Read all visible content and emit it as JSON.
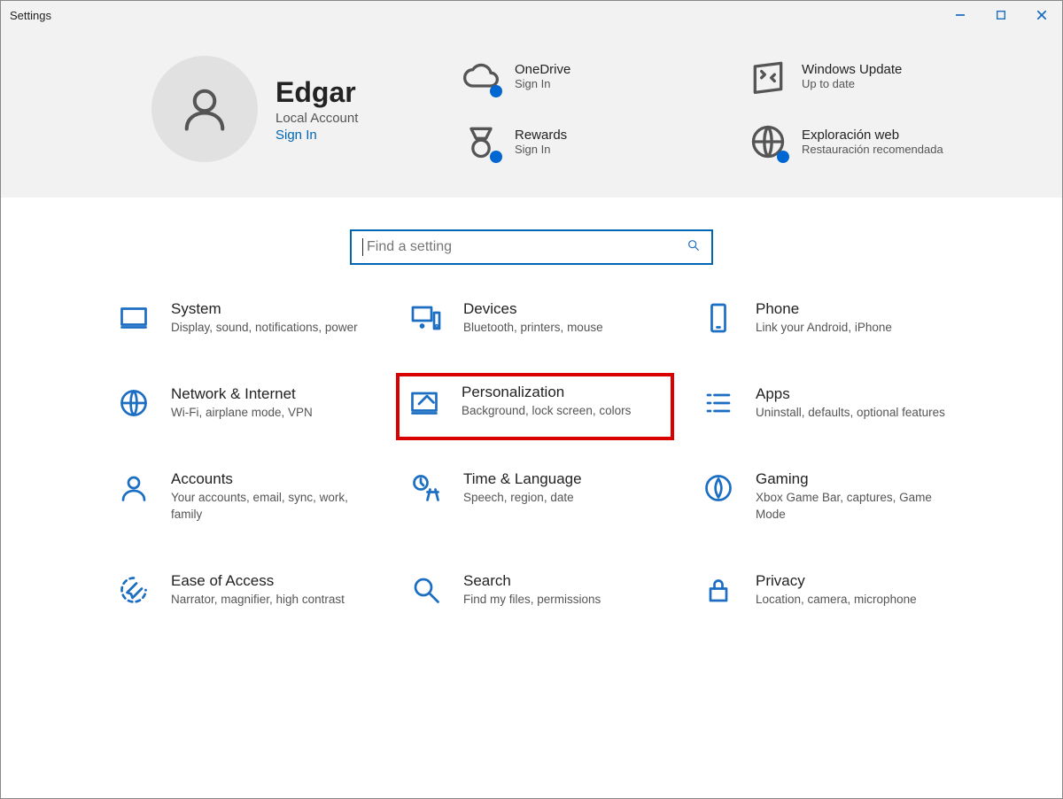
{
  "window": {
    "title": "Settings"
  },
  "account": {
    "name": "Edgar",
    "type": "Local Account",
    "signin": "Sign In"
  },
  "status": {
    "onedrive": {
      "title": "OneDrive",
      "sub": "Sign In"
    },
    "update": {
      "title": "Windows Update",
      "sub": "Up to date"
    },
    "rewards": {
      "title": "Rewards",
      "sub": "Sign In"
    },
    "web": {
      "title": "Exploración web",
      "sub": "Restauración recomendada"
    }
  },
  "search": {
    "placeholder": "Find a setting"
  },
  "tiles": {
    "system": {
      "title": "System",
      "sub": "Display, sound, notifications, power"
    },
    "devices": {
      "title": "Devices",
      "sub": "Bluetooth, printers, mouse"
    },
    "phone": {
      "title": "Phone",
      "sub": "Link your Android, iPhone"
    },
    "network": {
      "title": "Network & Internet",
      "sub": "Wi-Fi, airplane mode, VPN"
    },
    "personal": {
      "title": "Personalization",
      "sub": "Background, lock screen, colors"
    },
    "apps": {
      "title": "Apps",
      "sub": "Uninstall, defaults, optional features"
    },
    "accounts": {
      "title": "Accounts",
      "sub": "Your accounts, email, sync, work, family"
    },
    "time": {
      "title": "Time & Language",
      "sub": "Speech, region, date"
    },
    "gaming": {
      "title": "Gaming",
      "sub": "Xbox Game Bar, captures, Game Mode"
    },
    "ease": {
      "title": "Ease of Access",
      "sub": "Narrator, magnifier, high contrast"
    },
    "search": {
      "title": "Search",
      "sub": "Find my files, permissions"
    },
    "privacy": {
      "title": "Privacy",
      "sub": "Location, camera, microphone"
    }
  },
  "colors": {
    "accent": "#0066b4",
    "highlight": "#d90000"
  }
}
